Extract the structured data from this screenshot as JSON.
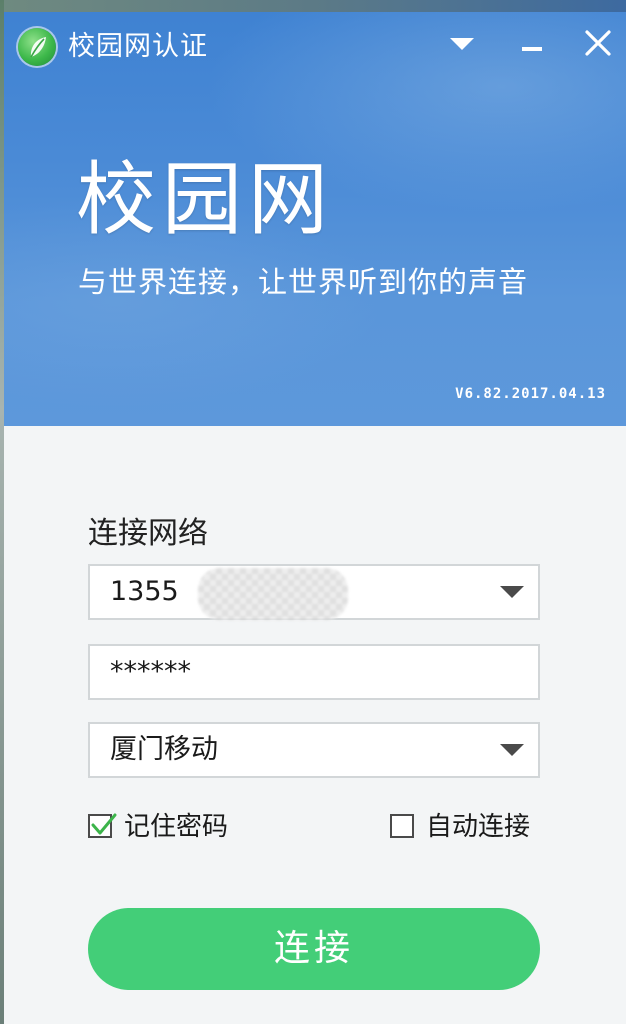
{
  "window": {
    "title": "校园网认证"
  },
  "banner": {
    "brand": "校园网",
    "slogan": "与世界连接，让世界听到你的声音",
    "version": "V6.82.2017.04.13"
  },
  "form": {
    "section_label": "连接网络",
    "account": {
      "value": "1355"
    },
    "password": {
      "value": "******"
    },
    "service": {
      "selected": "厦门移动"
    },
    "remember_password": {
      "label": "记住密码",
      "checked": true
    },
    "auto_connect": {
      "label": "自动连接",
      "checked": false
    },
    "connect_button": {
      "label": "连接"
    }
  },
  "icons": {
    "logo": "leaf-logo-icon",
    "menu": "chevron-down-icon",
    "minimize": "minimize-icon",
    "close": "close-icon",
    "dropdown": "triangle-down-icon",
    "check": "checkmark-icon"
  },
  "colors": {
    "banner_blue": "#4a8ad6",
    "button_green": "#43ce78",
    "check_green": "#3cb44a",
    "background": "#f3f5f6"
  }
}
